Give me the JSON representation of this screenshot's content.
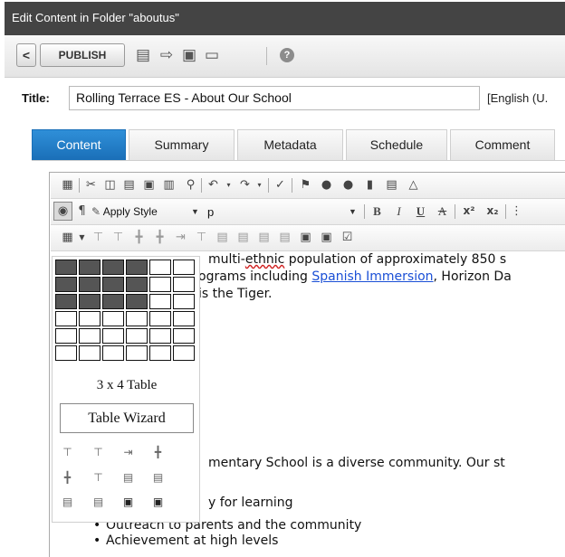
{
  "window": {
    "title": "Edit Content in Folder \"aboutus\""
  },
  "toolbar": {
    "back_label": "<",
    "publish_label": "PUBLISH",
    "help_label": "?",
    "icons": [
      "back-icon",
      "checkin-icon",
      "submit-icon",
      "save-icon",
      "preview-icon",
      "help-icon"
    ]
  },
  "form": {
    "title_label": "Title:",
    "title_value": "Rolling Terrace ES - About Our School",
    "language": "[English (U."
  },
  "tabs": [
    {
      "label": "Content",
      "active": true
    },
    {
      "label": "Summary",
      "active": false
    },
    {
      "label": "Metadata",
      "active": false
    },
    {
      "label": "Schedule",
      "active": false
    },
    {
      "label": "Comment",
      "active": false
    }
  ],
  "editor": {
    "style_select": "Apply Style",
    "format_select": "p",
    "bold_glyph": "B",
    "italic_glyph": "I",
    "underline_glyph": "U",
    "strike_glyph": "A",
    "superscript_glyph": "x²",
    "subscript_glyph": "x₂",
    "content": {
      "line1_pre": "multi-",
      "line1_word": "ethnic",
      "line1_post": " population of approximately 850 s",
      "line2_pre": "ograms including ",
      "line2_link": "Spanish Immersion",
      "line2_post": ", Horizon Da",
      "line3": "is the Tiger.",
      "line4": "mentary School is a diverse community. Our st",
      "line5": "y for learning",
      "bullets": [
        "Outreach to parents and the community",
        "Achievement at high levels"
      ]
    }
  },
  "table_popup": {
    "rows": 6,
    "cols": 6,
    "selected_rows": 3,
    "selected_cols": 4,
    "size_label": "3 x 4 Table",
    "wizard_label": "Table Wizard"
  },
  "colors": {
    "titlebar_bg": "#444444",
    "tab_active_bg": "#1f7fc9",
    "link": "#1a4fd6",
    "grid_selected": "#555555"
  }
}
